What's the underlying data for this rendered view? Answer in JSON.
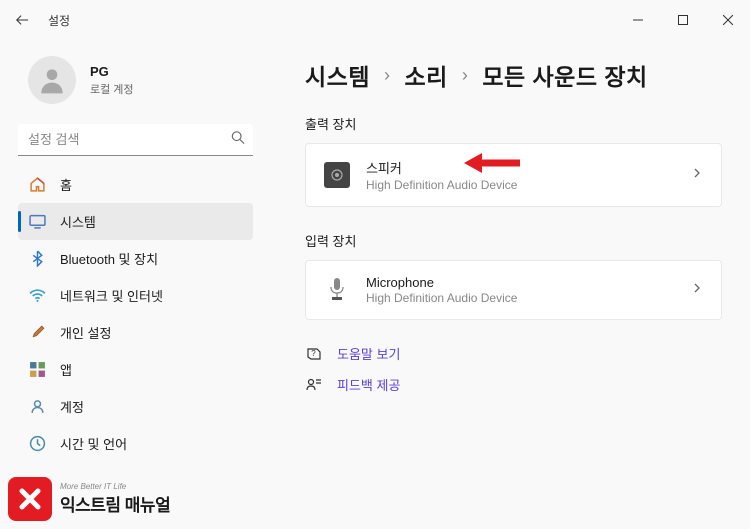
{
  "titlebar": {
    "app_name": "설정"
  },
  "user": {
    "name": "PG",
    "account_type": "로컬 계정"
  },
  "search": {
    "placeholder": "설정 검색"
  },
  "nav": [
    {
      "label": "홈"
    },
    {
      "label": "시스템"
    },
    {
      "label": "Bluetooth 및 장치"
    },
    {
      "label": "네트워크 및 인터넷"
    },
    {
      "label": "개인 설정"
    },
    {
      "label": "앱"
    },
    {
      "label": "계정"
    },
    {
      "label": "시간 및 언어"
    }
  ],
  "breadcrumb": {
    "l1": "시스템",
    "l2": "소리",
    "l3": "모든 사운드 장치"
  },
  "sections": {
    "output": {
      "title": "출력 장치",
      "device_name": "스피커",
      "device_desc": "High Definition Audio Device"
    },
    "input": {
      "title": "입력 장치",
      "device_name": "Microphone",
      "device_desc": "High Definition Audio Device"
    }
  },
  "help": {
    "get_help": "도움말 보기",
    "feedback": "피드백 제공"
  },
  "watermark": {
    "tagline": "More Better IT Life",
    "main": "익스트림 매뉴얼"
  }
}
